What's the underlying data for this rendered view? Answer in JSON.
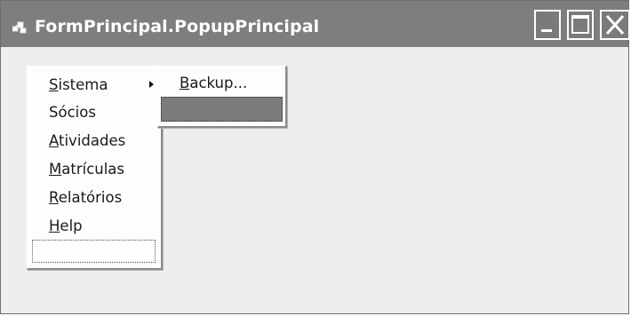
{
  "window": {
    "title": "FormPrincipal.PopupPrincipal",
    "buttons": {
      "minimize": "minimize-icon",
      "maximize": "maximize-icon",
      "close": "close-icon"
    }
  },
  "menu": {
    "items": [
      {
        "hotkey": "S",
        "rest": "istema",
        "submenu": true
      },
      {
        "hotkey": "",
        "rest": "Sócios",
        "submenu": false
      },
      {
        "hotkey": "A",
        "rest": "tividades",
        "submenu": false
      },
      {
        "hotkey": "M",
        "rest": "atrículas",
        "submenu": false
      },
      {
        "hotkey": "R",
        "rest": "elatórios",
        "submenu": false
      },
      {
        "hotkey": "H",
        "rest": "elp",
        "submenu": false
      }
    ],
    "submenu": {
      "items": [
        {
          "hotkey": "B",
          "rest": "ackup..."
        }
      ]
    }
  },
  "colors": {
    "titlebar": "#7e7e7e",
    "client": "#eeeeee",
    "menu": "#fdfdfd",
    "highlight": "#7c7c7c"
  }
}
